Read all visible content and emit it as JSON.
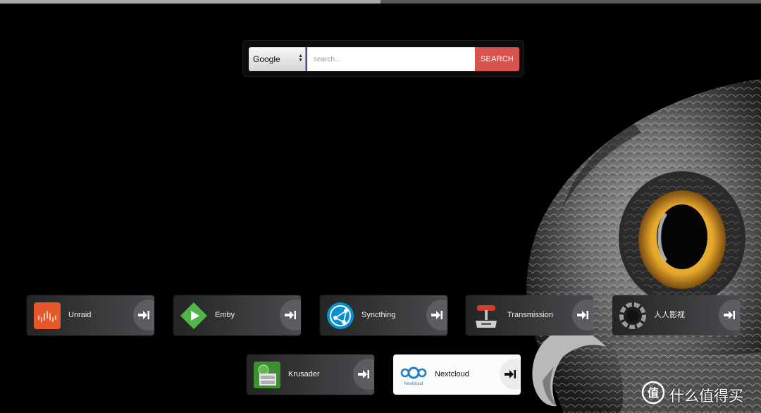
{
  "top_progress": {
    "value_percent": 50
  },
  "search": {
    "engine": "Google",
    "placeholder": "search...",
    "button_label": "SEARCH"
  },
  "apps": [
    {
      "label": "Unraid",
      "icon": "unraid-icon"
    },
    {
      "label": "Emby",
      "icon": "emby-icon"
    },
    {
      "label": "Syncthing",
      "icon": "syncthing-icon"
    },
    {
      "label": "Transmission",
      "icon": "transmission-icon"
    },
    {
      "label": "人人影视",
      "icon": "rrys-icon"
    },
    {
      "label": "Krusader",
      "icon": "krusader-icon"
    },
    {
      "label": "Nextcloud",
      "icon": "nextcloud-icon",
      "icon_caption": "Nextcloud"
    }
  ],
  "launch_icon": "launch-arrow-icon",
  "watermark": {
    "text": "什么值得买",
    "icon": "zdm-logo-icon"
  },
  "colors": {
    "background": "#000000",
    "search_button": "#d9534f",
    "tile_dark": "#3a3b3d",
    "tile_light": "#fbfbfb",
    "owl_iris": "#e5a72a"
  }
}
